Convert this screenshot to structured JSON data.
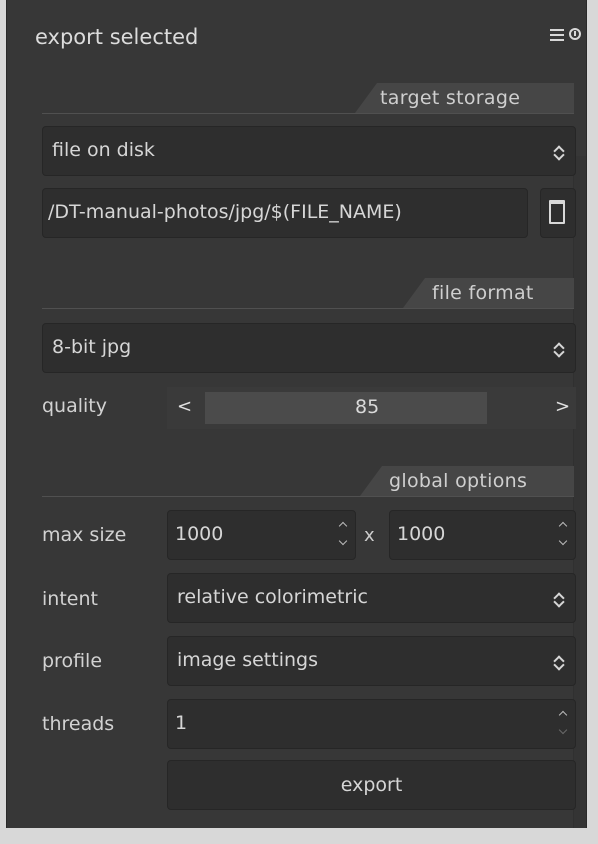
{
  "module": {
    "title": "export selected"
  },
  "icons": {
    "menu": "hamburger-icon",
    "power": "power-icon",
    "dropdown": "up-down-chevron-icon",
    "folder": "folder-icon"
  },
  "target_storage": {
    "section_label": "target storage",
    "storage_value": "file on disk",
    "path_value": "/DT-manual-photos/jpg/$(FILE_NAME)"
  },
  "file_format": {
    "section_label": "file format",
    "format_value": "8-bit jpg",
    "quality_label": "quality",
    "quality_value": "85",
    "quality_left": "<",
    "quality_right": ">"
  },
  "global_options": {
    "section_label": "global options",
    "max_size_label": "max size",
    "max_width": "1000",
    "times": "x",
    "max_height": "1000",
    "intent_label": "intent",
    "intent_value": "relative colorimetric",
    "profile_label": "profile",
    "profile_value": "image settings",
    "threads_label": "threads",
    "threads_value": "1"
  },
  "actions": {
    "export_label": "export"
  },
  "colors": {
    "panel_bg": "#373737",
    "widget_bg": "#2e2e2e",
    "section_tab": "#464646",
    "text": "#d6d6d6"
  }
}
